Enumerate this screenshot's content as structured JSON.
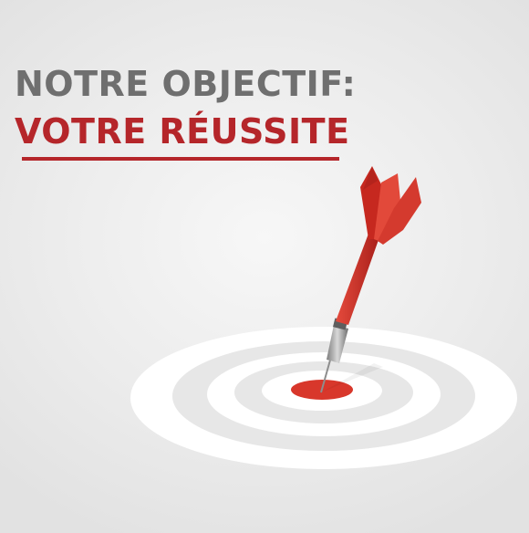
{
  "headline": {
    "line1": "NOTRE OBJECTIF:",
    "line2": "VOTRE RÉUSSITE"
  },
  "colors": {
    "line1_text": "#6f6f6f",
    "line2_text": "#b5262a",
    "accent_red": "#d8372b",
    "dart_red_dark": "#a81f1a",
    "target_ring": "#ffffff",
    "target_gap": "#e6e6e6",
    "metal": "#9a9a9a"
  },
  "icons": [
    "dart-icon",
    "target-icon"
  ]
}
